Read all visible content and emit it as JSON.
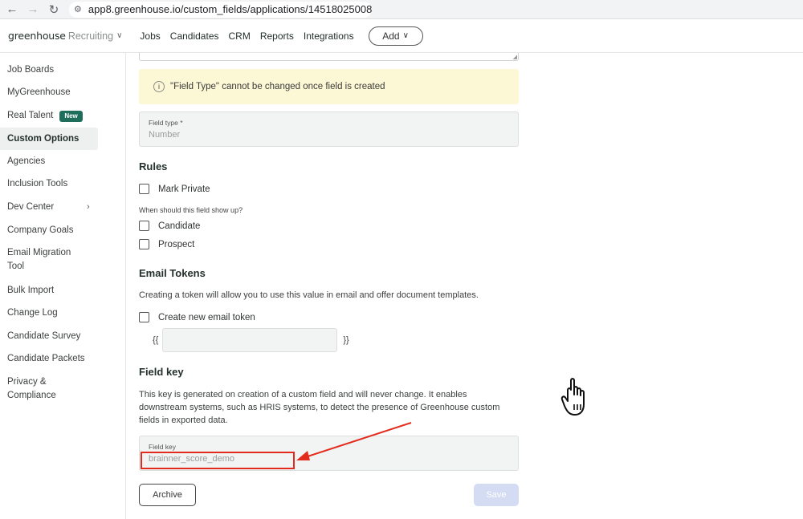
{
  "browser": {
    "url": "app8.greenhouse.io/custom_fields/applications/14518025008"
  },
  "topnav": {
    "brand_main": "greenhouse",
    "brand_sub": "Recruiting",
    "links": [
      "Jobs",
      "Candidates",
      "CRM",
      "Reports",
      "Integrations"
    ],
    "add_label": "Add"
  },
  "sidebar": {
    "items": [
      {
        "label": "Job Boards"
      },
      {
        "label": "MyGreenhouse"
      },
      {
        "label": "Real Talent",
        "badge": "New"
      },
      {
        "label": "Custom Options",
        "active": true
      },
      {
        "label": "Agencies"
      },
      {
        "label": "Inclusion Tools"
      },
      {
        "label": "Dev Center"
      },
      {
        "label": "Company Goals"
      },
      {
        "label": "Email Migration Tool"
      },
      {
        "label": "Bulk Import"
      },
      {
        "label": "Change Log"
      },
      {
        "label": "Candidate Survey"
      },
      {
        "label": "Candidate Packets"
      },
      {
        "label": "Privacy & Compliance"
      }
    ]
  },
  "form": {
    "notice": "\"Field Type\" cannot be changed once field is created",
    "field_type_label": "Field type *",
    "field_type_value": "Number",
    "rules_title": "Rules",
    "mark_private": "Mark Private",
    "show_up_question": "When should this field show up?",
    "candidate": "Candidate",
    "prospect": "Prospect",
    "email_tokens_title": "Email Tokens",
    "email_tokens_desc": "Creating a token will allow you to use this value in email and offer document templates.",
    "create_token": "Create new email token",
    "token_open": "{{",
    "token_close": "}}",
    "field_key_title": "Field key",
    "field_key_desc": "This key is generated on creation of a custom field and will never change. It enables downstream systems, such as HRIS systems, to detect the presence of Greenhouse custom fields in exported data.",
    "field_key_label": "Field key",
    "field_key_value": "brainner_score_demo",
    "archive": "Archive",
    "save": "Save"
  },
  "colors": {
    "accent_green": "#1f6e5b",
    "notice_bg": "#fcf8d6",
    "annotation_red": "#e32b1d",
    "save_disabled": "#d3dcf3"
  }
}
